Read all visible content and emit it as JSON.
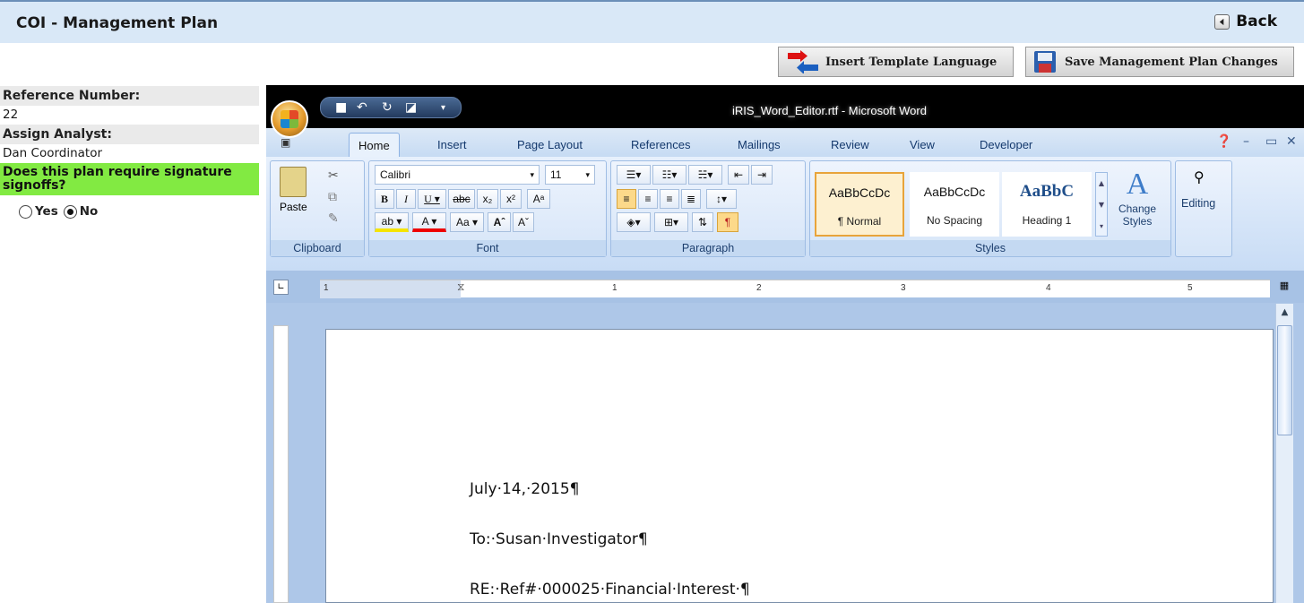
{
  "header": {
    "title": "COI - Management Plan",
    "back_label": "Back"
  },
  "toolbar": {
    "insert_template_label": "Insert Template Language",
    "save_plan_label": "Save Management Plan Changes"
  },
  "form": {
    "reference_label": "Reference Number:",
    "reference_value": "22",
    "analyst_label": "Assign Analyst:",
    "analyst_value": "Dan Coordinator",
    "signoff_question": "Does this plan require signature signoffs?",
    "yes_label": "Yes",
    "no_label": "No",
    "selected": "No"
  },
  "word": {
    "window_title": "iRIS_Word_Editor.rtf - Microsoft Word",
    "tabs": [
      "Home",
      "Insert",
      "Page Layout",
      "References",
      "Mailings",
      "Review",
      "View",
      "Developer"
    ],
    "active_tab": "Home",
    "clipboard": {
      "label": "Clipboard",
      "paste": "Paste"
    },
    "font": {
      "label": "Font",
      "name": "Calibri",
      "size": "11"
    },
    "paragraph": {
      "label": "Paragraph"
    },
    "styles": {
      "label": "Styles",
      "items": [
        {
          "sample": "AaBbCcDc",
          "name": "¶ Normal"
        },
        {
          "sample": "AaBbCcDc",
          "name": "No Spacing"
        },
        {
          "sample": "AaBbC",
          "name": "Heading 1"
        }
      ],
      "change_styles": "Change Styles"
    },
    "editing": {
      "label": "Editing"
    },
    "ruler_numbers": [
      "1",
      "1",
      "2",
      "3",
      "4",
      "5"
    ],
    "document_lines": [
      "July·14,·2015¶",
      "To:·Susan·Investigator¶",
      "RE:·Ref#·000025·Financial·Interest·¶"
    ]
  },
  "colors": {
    "header_bg": "#d9e8f7",
    "highlight": "#82ea42",
    "word_frame": "#aec7e8"
  }
}
